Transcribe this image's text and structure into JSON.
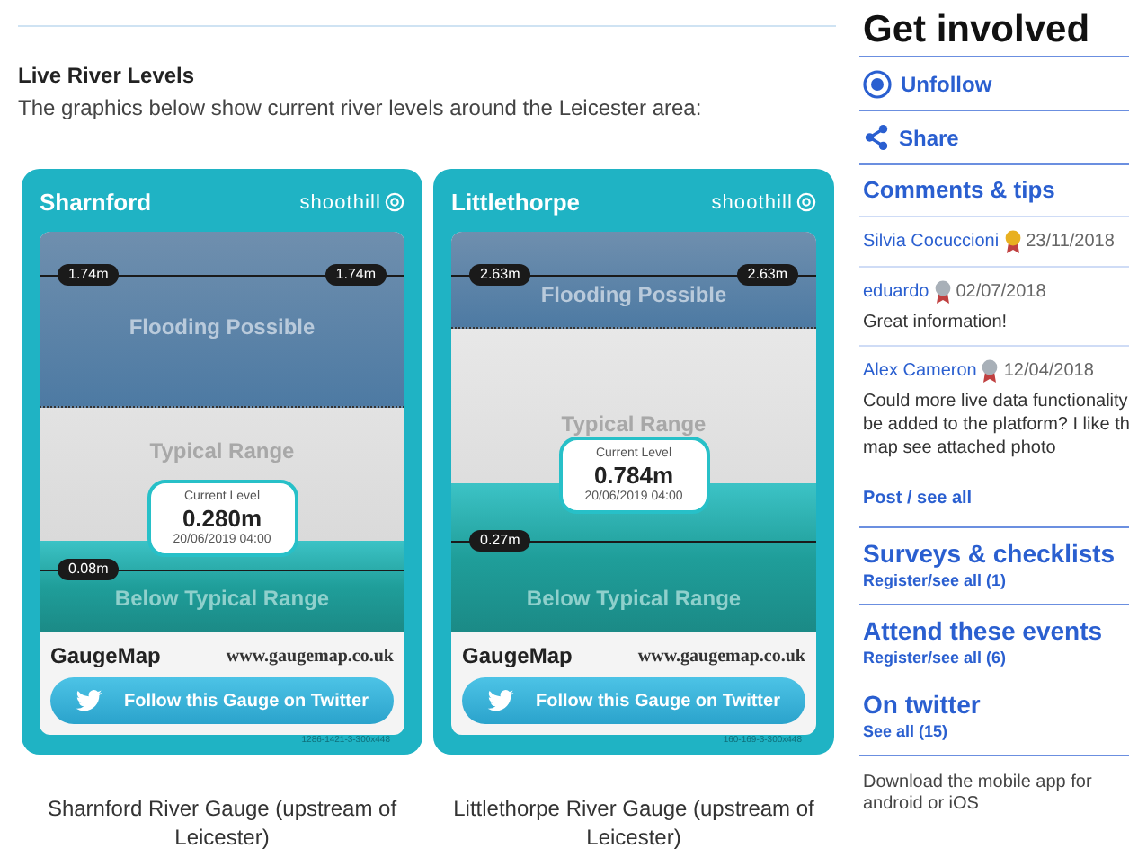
{
  "section": {
    "title": "Live River Levels",
    "intro": "The graphics below show current river levels around the Leicester area:"
  },
  "gauges": [
    {
      "name": "Sharnford",
      "brand": "shoothill",
      "upper": "1.74m",
      "upper_right": "1.74m",
      "lower": "0.08m",
      "flood_label": "Flooding Possible",
      "typical_label": "Typical Range",
      "below_label": "Below Typical Range",
      "level": 0.23,
      "current_title": "Current Level",
      "current_value": "0.280m",
      "current_time": "20/06/2019 04:00",
      "footer_brand": "GaugeMap",
      "footer_url": "www.gaugemap.co.uk",
      "twitter": "Follow this Gauge on Twitter",
      "code": "1286-1421-3-300x448",
      "caption": "Sharnford River Gauge (upstream of Leicester)"
    },
    {
      "name": "Littlethorpe",
      "brand": "shoothill",
      "upper": "2.63m",
      "upper_right": "2.63m",
      "lower": "0.27m",
      "flood_label": "Flooding Possible",
      "typical_label": "Typical Range",
      "below_label": "Below Typical Range",
      "level": 0.37,
      "current_title": "Current Level",
      "current_value": "0.784m",
      "current_time": "20/06/2019 04:00",
      "footer_brand": "GaugeMap",
      "footer_url": "www.gaugemap.co.uk",
      "twitter": "Follow this Gauge on Twitter",
      "code": "160-169-3-300x448",
      "caption": "Littlethorpe River Gauge (upstream of Leicester)"
    }
  ],
  "sidebar": {
    "title": "Get involved",
    "actions": [
      {
        "kind": "follow",
        "label": "Unfollow"
      },
      {
        "kind": "share",
        "label": "Share"
      }
    ],
    "comments_title": "Comments & tips",
    "comments": [
      {
        "author": "Silvia Cocuccioni",
        "color": "#e8b020",
        "date": "23/11/2018"
      },
      {
        "author": "eduardo",
        "color": "#a8b0b8",
        "date": "02/07/2018",
        "text": "Great information!"
      },
      {
        "author": "Alex Cameron",
        "color": "#a8b0b8",
        "date": "12/04/2018",
        "lines": [
          "Could more live data functionality",
          "be added to the platform? I like th",
          "map see attached photo"
        ]
      }
    ],
    "post_link": "Post / see all",
    "sections": [
      {
        "title": "Surveys & checklists",
        "link": "Register/see all (1)"
      },
      {
        "title": "Attend these events",
        "link": "Register/see all (6)"
      },
      {
        "title": "On twitter",
        "link": "See all (15)"
      }
    ],
    "app_text": "Download the mobile app for android or iOS"
  }
}
